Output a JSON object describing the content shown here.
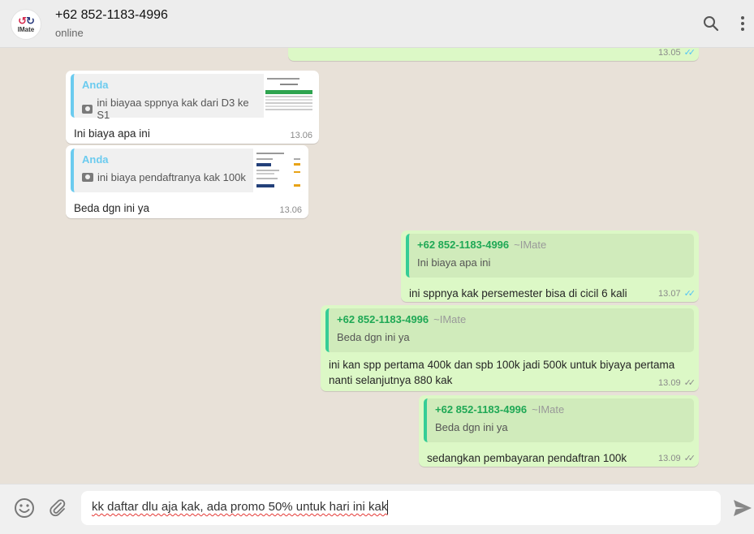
{
  "header": {
    "avatar_logo": "IMate",
    "contact_name": "+62 852-1183-4996",
    "status": "online",
    "icons": [
      "search-icon",
      "menu-dots-icon"
    ]
  },
  "messages": [
    {
      "direction": "out",
      "time": "13.05",
      "ticks": "read"
    },
    {
      "direction": "in",
      "quote_author": "Anda",
      "quote_text": "ini biayaa sppnya kak dari D3 ke S1",
      "text": "Ini biaya apa ini",
      "time": "13.06"
    },
    {
      "direction": "in",
      "quote_author": "Anda",
      "quote_text": "ini biaya pendaftranya kak 100k",
      "text": "Beda dgn ini ya",
      "time": "13.06"
    },
    {
      "direction": "out",
      "quote_author": "+62 852-1183-4996",
      "quote_push": "~IMate",
      "quote_text": "Ini biaya apa ini",
      "text": "ini sppnya kak persemester bisa di cicil 6 kali",
      "time": "13.07",
      "ticks": "read"
    },
    {
      "direction": "out",
      "quote_author": "+62 852-1183-4996",
      "quote_push": "~IMate",
      "quote_text": "Beda dgn ini ya",
      "text_line1": "ini kan spp pertama 400k dan spb 100k jadi 500k untuk biyaya pertama",
      "text_line2": "nanti selanjutnya 880 kak",
      "time": "13.09",
      "ticks": "delivered"
    },
    {
      "direction": "out",
      "quote_author": "+62 852-1183-4996",
      "quote_push": "~IMate",
      "quote_text": "Beda dgn ini ya",
      "text": "sedangkan pembayaran pendaftran 100k",
      "time": "13.09",
      "ticks": "delivered"
    }
  ],
  "composer": {
    "draft": "kk daftar dlu aja kak, ada promo 50% untuk hari ini kak",
    "icons": [
      "emoji-icon",
      "attach-icon",
      "send-icon"
    ]
  },
  "colors": {
    "header_bg": "#ededed",
    "chat_bg": "#e8e1d8",
    "outgoing_bubble": "#dcf8c6",
    "incoming_bubble": "#ffffff",
    "quote_incoming_accent": "#6bcbef",
    "quote_outgoing_accent": "#35cd96",
    "read_ticks": "#4fc3f7"
  }
}
